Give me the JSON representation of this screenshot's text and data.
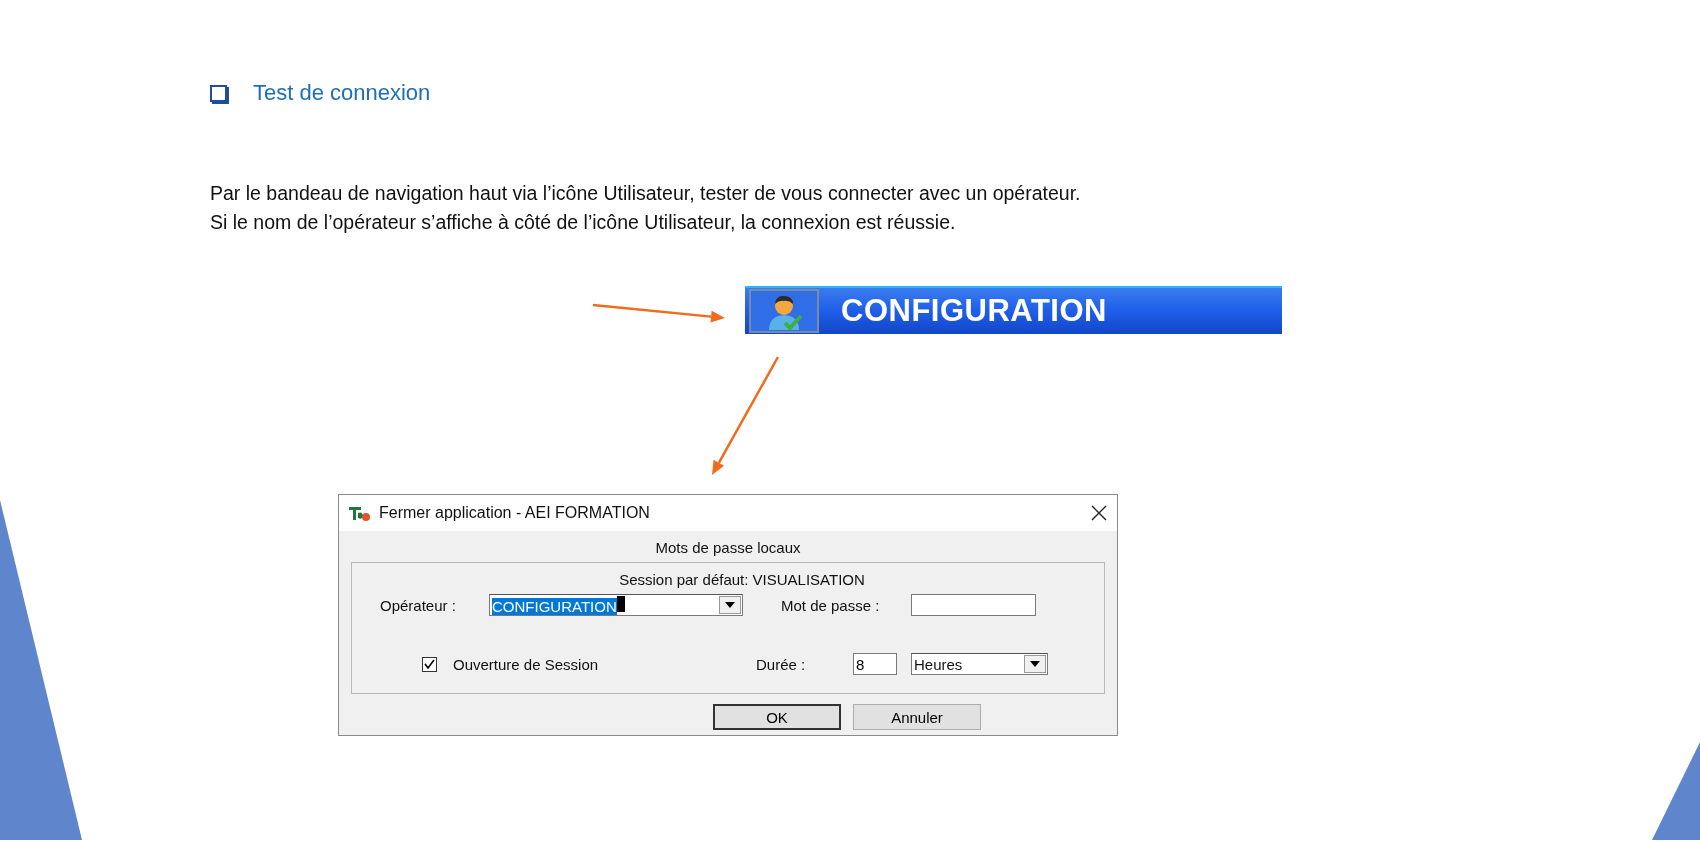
{
  "heading": {
    "text": "Test de connexion"
  },
  "paragraph": [
    "Par le bandeau de navigation haut  via l’icône Utilisateur, tester de vous connecter avec un opérateur.",
    "Si le nom de l’opérateur s’affiche à côté de l’icône Utilisateur, la connexion est réussie."
  ],
  "banner": {
    "label": "CONFIGURATION"
  },
  "dialog": {
    "title": "Fermer application - AEI FORMATION",
    "subtitle": "Mots de passe locaux",
    "session_default": "Session par défaut: VISUALISATION",
    "operator": {
      "label": "Opérateur :",
      "value": "CONFIGURATION"
    },
    "password": {
      "label": "Mot de passe :"
    },
    "open_session": {
      "label": "Ouverture de Session",
      "checked": true
    },
    "duration": {
      "label": "Durée :",
      "value": "8",
      "unit": "Heures"
    },
    "buttons": [
      "OK",
      "Annuler"
    ]
  }
}
